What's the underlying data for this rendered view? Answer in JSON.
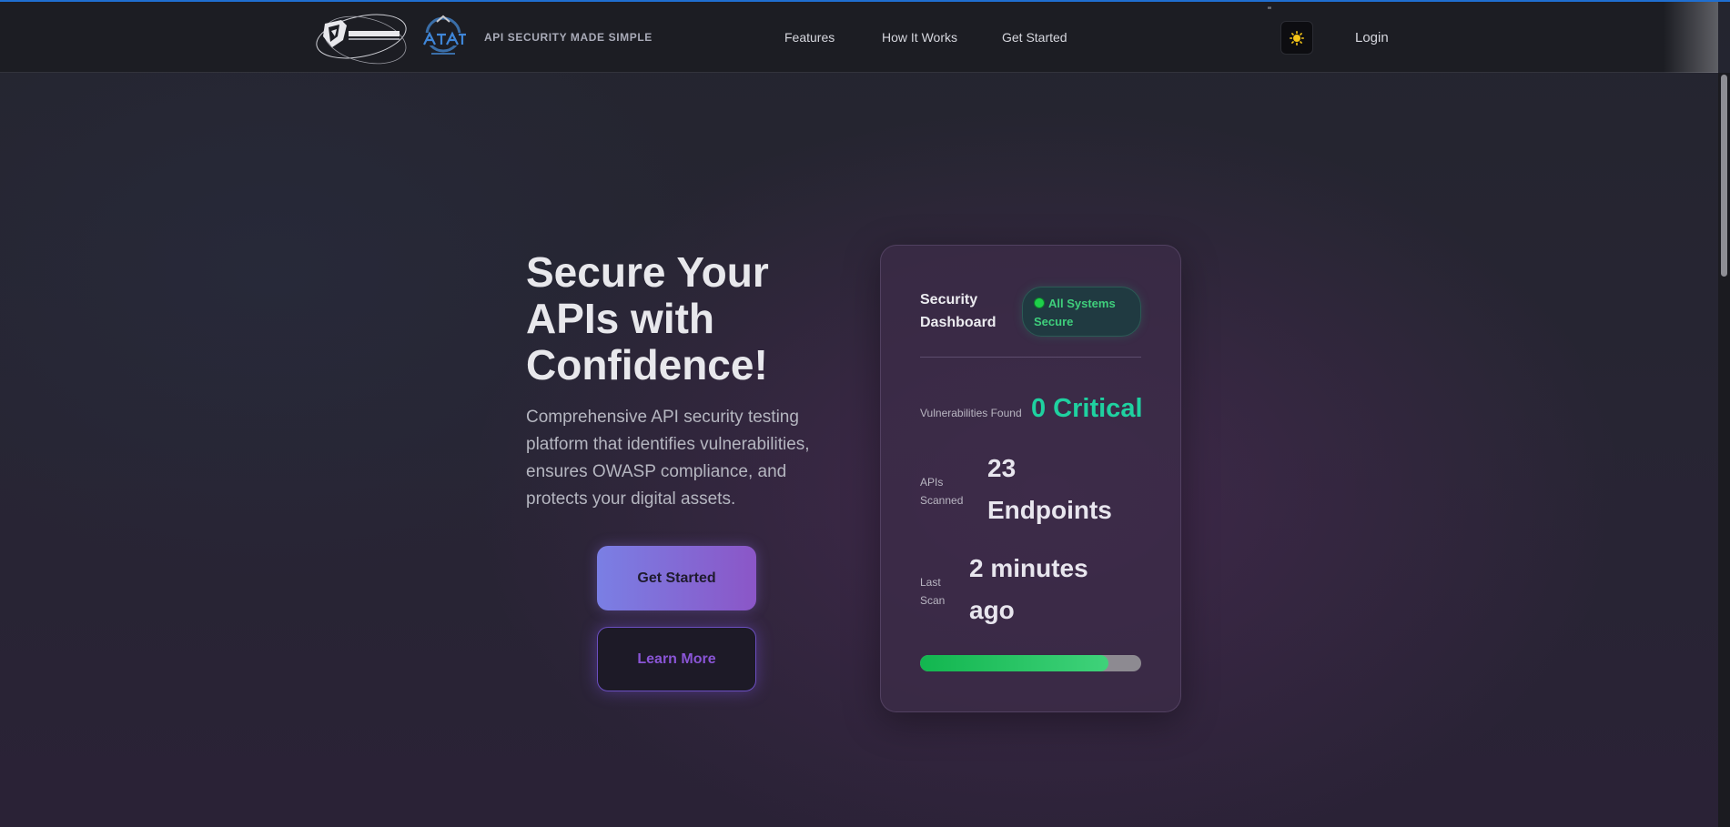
{
  "nav": {
    "tagline": "API SECURITY MADE SIMPLE",
    "links": [
      "Features",
      "How It Works",
      "Get Started"
    ],
    "quote_mark": "\"",
    "login": "Login"
  },
  "hero": {
    "title": "Secure Your APIs with Confidence!",
    "subtitle": "Comprehensive API security testing platform that identifies vulnerabilities, ensures OWASP compliance, and protects your digital assets.",
    "primary_button": "Get Started",
    "secondary_button": "Learn More"
  },
  "dashboard": {
    "title": "Security Dashboard",
    "status": "All Systems Secure",
    "vulnerabilities_label": "Vulnerabilities Found",
    "vulnerabilities_value": "0 Critical",
    "apis_label": "APIs Scanned",
    "apis_value": "23 Endpoints",
    "last_scan_label": "Last Scan",
    "last_scan_value": "2 minutes ago",
    "progress_fraction": 0.85
  },
  "colors": {
    "accent_green": "#1fd1a0",
    "status_green": "#3fcf7c",
    "primary_gradient_start": "#7a7fe4",
    "primary_gradient_end": "#8b56c7",
    "secondary_text": "#8a55d6",
    "top_line": "#1f6fd1"
  },
  "icons": {
    "theme_toggle": "sun-icon",
    "status": "green-dot-icon"
  }
}
